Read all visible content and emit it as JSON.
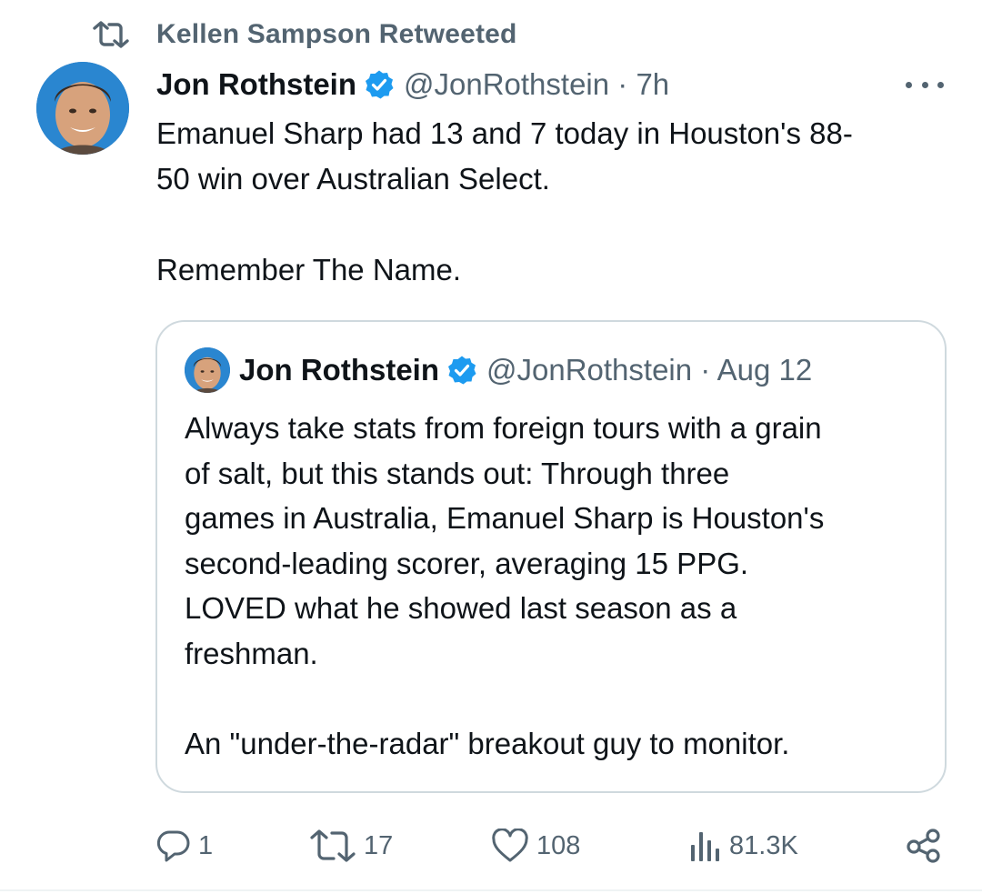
{
  "retweet": {
    "icon": "retweet-icon",
    "text": "Kellen Sampson Retweeted"
  },
  "tweet": {
    "author_name": "Jon Rothstein",
    "verified_icon": "verified-badge-icon",
    "handle_time": "@JonRothstein · 7h",
    "more_icon": "more-icon",
    "lines": [
      "Emanuel Sharp had 13 and 7 today in Houston's 88-",
      "50 win over Australian Select.",
      "Remember The Name."
    ]
  },
  "quote": {
    "author_name": "Jon Rothstein",
    "handle_time": "@JonRothstein · Aug 12",
    "lines": [
      "Always take stats from foreign tours with a grain",
      "of salt, but this stands out: Through three",
      "games in Australia, Emanuel Sharp is Houston's",
      "second-leading scorer, averaging 15 PPG.",
      "LOVED what he showed last season as a",
      "freshman.",
      "An \"under-the-radar\" breakout guy to monitor."
    ]
  },
  "actions": {
    "reply": {
      "icon": "reply-icon",
      "count": "1"
    },
    "retweet": {
      "icon": "retweet-icon",
      "count": "17"
    },
    "like": {
      "icon": "heart-icon",
      "count": "108"
    },
    "views": {
      "icon": "views-icon",
      "count": "81.3K"
    },
    "share": {
      "icon": "share-icon"
    }
  },
  "colors": {
    "text": "#0f1419",
    "secondary": "#536471",
    "verified": "#1d9bf0",
    "border": "#cfd9de"
  }
}
